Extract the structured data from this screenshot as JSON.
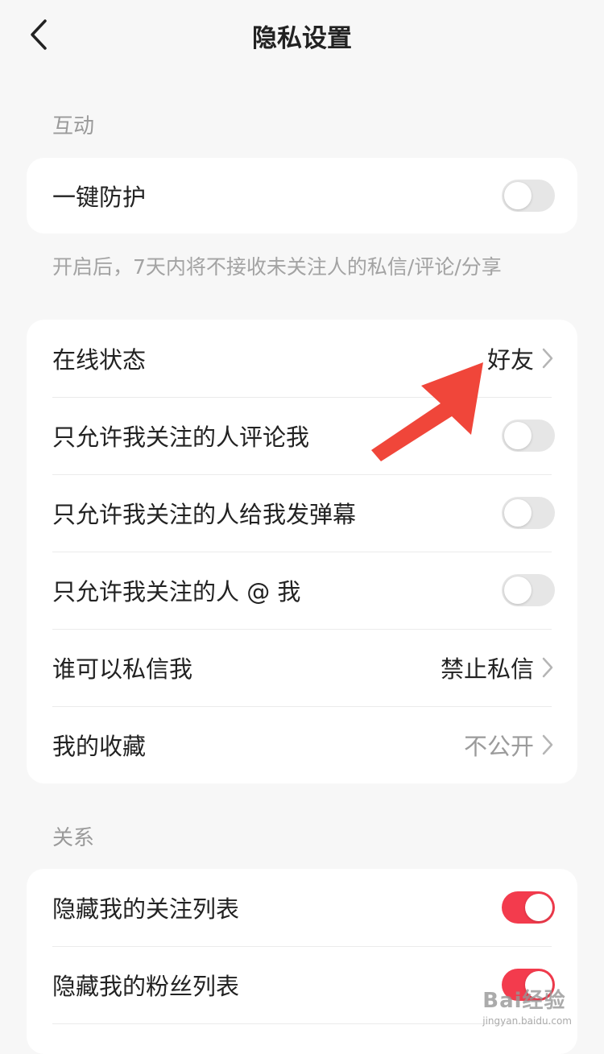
{
  "header": {
    "title": "隐私设置"
  },
  "sections": {
    "interaction": {
      "title": "互动",
      "protection": {
        "label": "一键防护",
        "enabled": false
      },
      "hint": "开启后，7天内将不接收未关注人的私信/评论/分享"
    },
    "settings": [
      {
        "label": "在线状态",
        "value": "好友"
      },
      {
        "label": "只允许我关注的人评论我",
        "enabled": false
      },
      {
        "label": "只允许我关注的人给我发弹幕",
        "enabled": false
      },
      {
        "label": "只允许我关注的人 @ 我",
        "enabled": false
      },
      {
        "label": "谁可以私信我",
        "value": "禁止私信"
      },
      {
        "label": "我的收藏",
        "value": "不公开"
      }
    ],
    "relations": {
      "title": "关系",
      "items": [
        {
          "label": "隐藏我的关注列表",
          "enabled": true
        },
        {
          "label": "隐藏我的粉丝列表",
          "enabled": true
        }
      ]
    }
  },
  "colors": {
    "background": "#f7f7f7",
    "accent": "#f33b4d",
    "annotation": "#f0463a"
  },
  "icons": {
    "back": "chevron-left-icon",
    "chevron": "chevron-right-icon",
    "annotation": "red-arrow-icon"
  },
  "watermark": {
    "main": "Bai经验",
    "sub": "jingyan.baidu.com"
  }
}
